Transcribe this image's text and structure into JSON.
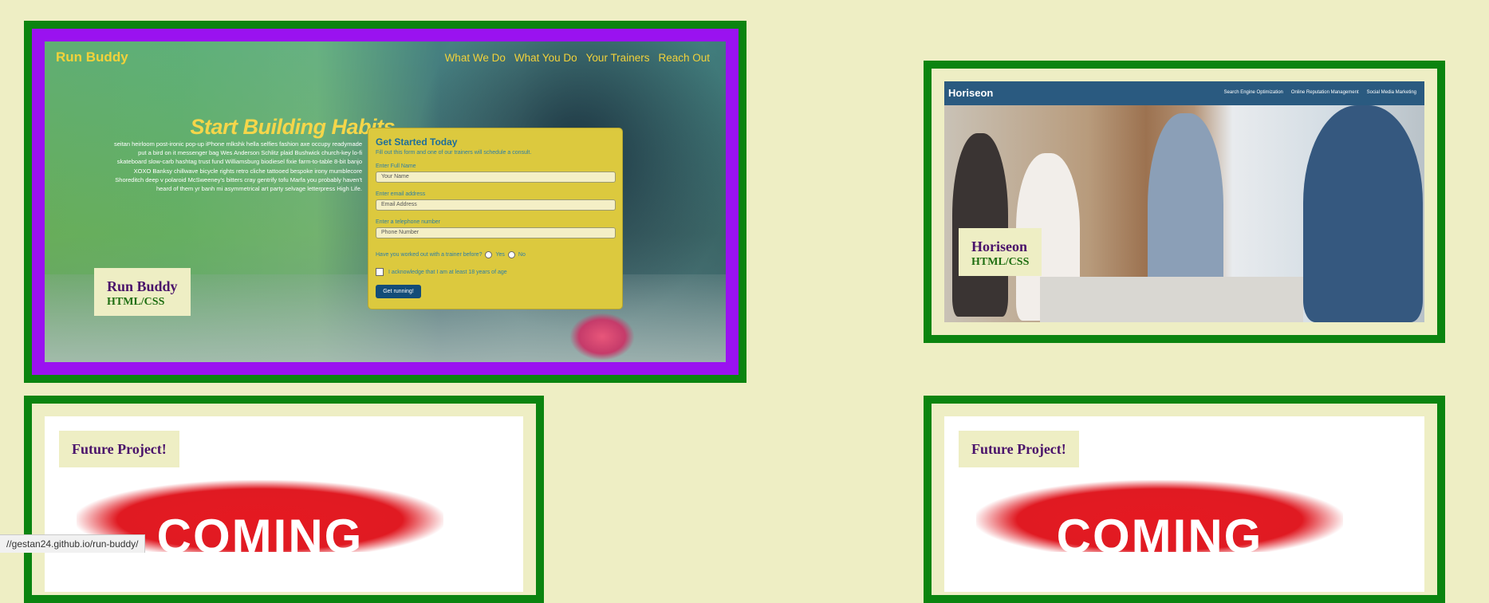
{
  "projects": [
    {
      "label": "Run Buddy",
      "tech": "HTML/CSS",
      "preview": {
        "brand": "Run Buddy",
        "nav": [
          "What We Do",
          "What You Do",
          "Your Trainers",
          "Reach Out"
        ],
        "headline": "Start Building Habits.",
        "blurb": "seitan heirloom post-ironic pop-up iPhone mlkshk hella selfies fashion axe occupy readymade put a bird on it messenger bag Wes Anderson Schlitz plaid Bushwick church-key lo-fi skateboard slow-carb hashtag trust fund Williamsburg biodiesel fixie farm-to-table 8-bit banjo XOXO Banksy chillwave bicycle rights retro cliche tattooed bespoke irony mumblecore Shoreditch deep v polaroid McSweeney's bitters cray gentrify tofu Marfa you probably haven't heard of them yr banh mi asymmetrical art party selvage letterpress High Life.",
        "form": {
          "title": "Get Started Today",
          "subtitle": "Fill out this form and one of our trainers will schedule a consult.",
          "name_label": "Enter Full Name",
          "name_placeholder": "Your Name",
          "email_label": "Enter email address",
          "email_placeholder": "Email Address",
          "phone_label": "Enter a telephone number",
          "phone_placeholder": "Phone Number",
          "question": "Have you worked out with a trainer before?",
          "yes": "Yes",
          "no": "No",
          "acknowledge": "I acknowledge that I am at least 18 years of age",
          "submit": "Get running!"
        }
      }
    },
    {
      "label": "Horiseon",
      "tech": "HTML/CSS",
      "preview": {
        "brand": "Horiseon",
        "nav": [
          "Search Engine Optimization",
          "Online Reputation Management",
          "Social Media Marketing"
        ]
      }
    },
    {
      "label": "Future Project!",
      "preview": {
        "banner": "COMING SOON"
      }
    },
    {
      "label": "Future Project!",
      "preview": {
        "banner": "COMING SOON"
      }
    }
  ],
  "status_url": "//gestan24.github.io/run-buddy/",
  "colors": {
    "page_bg": "#eeeec4",
    "card_border": "#0b8410",
    "hover_bg": "#9a12f0",
    "label_title": "#4a136b",
    "label_tech": "#1f6e12"
  }
}
